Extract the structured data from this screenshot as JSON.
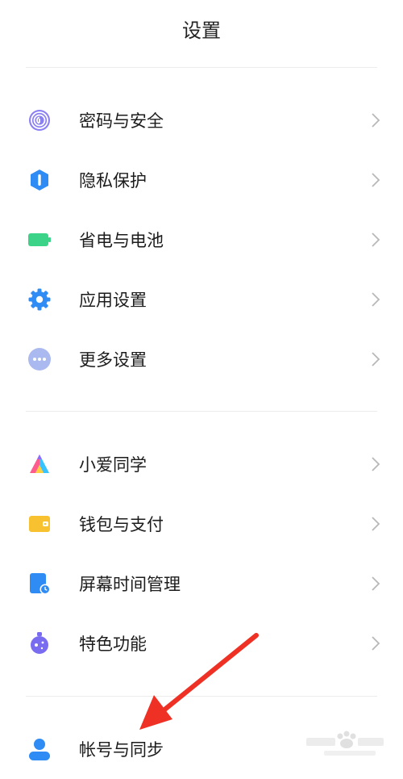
{
  "header": {
    "title": "设置"
  },
  "group1": [
    {
      "label": "密码与安全",
      "icon": "fingerprint-icon"
    },
    {
      "label": "隐私保护",
      "icon": "privacy-shield-icon"
    },
    {
      "label": "省电与电池",
      "icon": "battery-icon"
    },
    {
      "label": "应用设置",
      "icon": "gear-icon"
    },
    {
      "label": "更多设置",
      "icon": "more-dots-icon"
    }
  ],
  "group2": [
    {
      "label": "小爱同学",
      "icon": "xiaoai-icon"
    },
    {
      "label": "钱包与支付",
      "icon": "wallet-icon"
    },
    {
      "label": "屏幕时间管理",
      "icon": "screen-time-icon"
    },
    {
      "label": "特色功能",
      "icon": "special-features-icon"
    }
  ],
  "group3": [
    {
      "label": "帐号与同步",
      "icon": "account-icon"
    }
  ],
  "colors": {
    "arrow": "#ee3124",
    "icon_blue": "#2f8cf4",
    "icon_green": "#3ad387",
    "icon_purple": "#7a6cf0",
    "icon_yellow": "#f8c12f"
  }
}
